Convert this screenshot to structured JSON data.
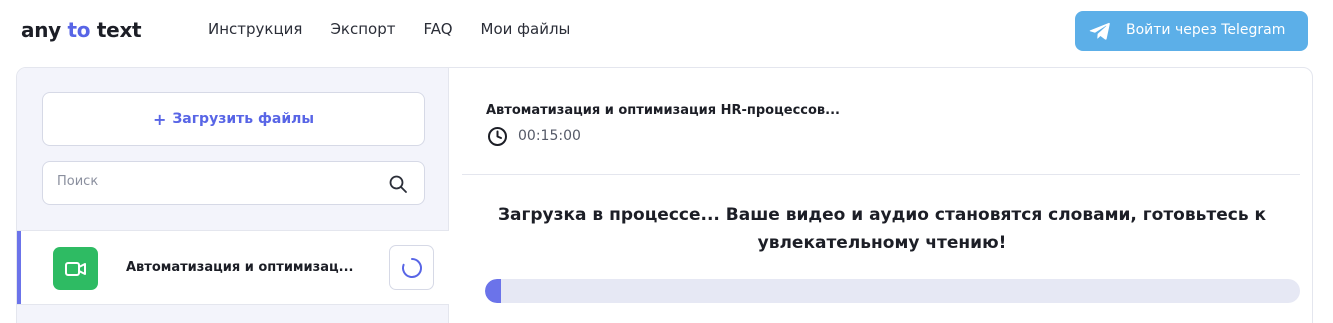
{
  "header": {
    "logo": {
      "part1": "any ",
      "part2": "to",
      "part3": " text"
    },
    "nav": [
      "Инструкция",
      "Экспорт",
      "FAQ",
      "Мои файлы"
    ],
    "login_button": "Войти через Telegram"
  },
  "sidebar": {
    "upload_button": {
      "icon": "+",
      "label": "Загрузить файлы"
    },
    "search": {
      "placeholder": "Поиск",
      "value": ""
    },
    "files": [
      {
        "name": "Автоматизация и оптимизац...",
        "icon": "video-camera-icon",
        "status": "loading-spinner-icon"
      }
    ]
  },
  "main": {
    "title": "Автоматизация и оптимизация HR-процессов...",
    "duration": "00:15:00",
    "status_message": "Загрузка в процессе... Ваше видео и аудио становятся словами, готовьтесь к увлекательному чтению!",
    "progress_percent": 2
  },
  "colors": {
    "accent": "#5865e6",
    "telegram": "#5cafe8",
    "file_icon": "#2ebb63",
    "progress": "#6b73ea"
  }
}
